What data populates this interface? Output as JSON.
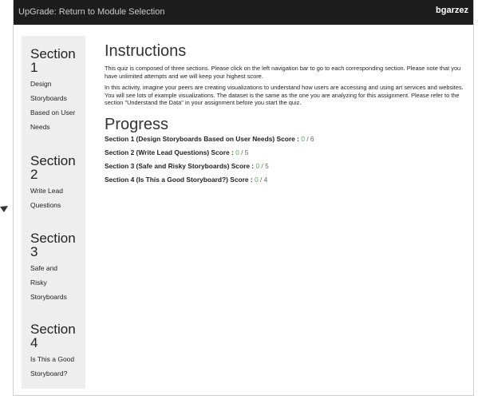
{
  "topbar": {
    "back_link": "UpGrade: Return to Module Selection",
    "user": "bgarzez"
  },
  "sidebar": {
    "sections": [
      {
        "heading": "Section\n1",
        "desc": "Design\nStoryboards\nBased on User\nNeeds"
      },
      {
        "heading": "Section\n2",
        "desc": "Write Lead\nQuestions"
      },
      {
        "heading": "Section\n3",
        "desc": "Safe and\nRisky\nStoryboards"
      },
      {
        "heading": "Section\n4",
        "desc": "Is This a Good\nStoryboard?"
      }
    ]
  },
  "main": {
    "instructions_title": "Instructions",
    "paragraph1": "This quiz is composed of three sections. Please click on the left navigation bar to go to each corresponding section. Please note that you have unlimited attempts and we will keep your highest score.",
    "paragraph2": "In this activity, imagine your peers are creating visualizations to understand how users are accessing and using art services and websites. You will see lots of example visualizations. The dataset is the same as the one you are analyzing for this assignment. Please refer to the section \"Understand the Data\" in your assignment before you start the quiz.",
    "progress_title": "Progress",
    "progress": [
      {
        "label": "Section 1 (Design Storyboards Based on User Needs) Score : ",
        "score": "0",
        "total": " / 6"
      },
      {
        "label": "Section 2 (Write Lead Questions) Score : ",
        "score": "0",
        "total": " / 5"
      },
      {
        "label": "Section 3 (Safe and Risky Storyboards) Score : ",
        "score": "0",
        "total": " / 5"
      },
      {
        "label": "Section 4 (Is This a Good Storyboard?) Score : ",
        "score": "0",
        "total": " / 4"
      }
    ]
  },
  "colors": {
    "topbar_bg": "#1d1d1d",
    "sidebar_bg": "#eeeeee",
    "score_green": "#4caf50"
  }
}
